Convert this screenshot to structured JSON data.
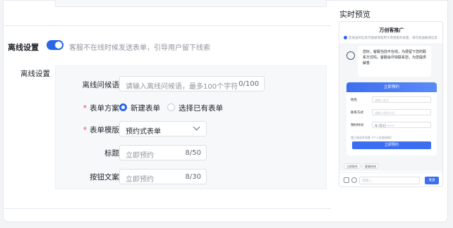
{
  "offline": {
    "label": "离线设置",
    "toggle_on": true,
    "description": "客服不在线时候发送表单，引导用户留下线索",
    "section_label": "离线设置"
  },
  "form": {
    "greeting": {
      "label": "离线问候语",
      "placeholder": "请输入离线问候语，最多100个字符",
      "count": "0/100"
    },
    "scheme": {
      "label": "表单方案",
      "required": "*",
      "options": [
        "新建表单",
        "选择已有表单"
      ],
      "selected": "新建表单"
    },
    "template": {
      "label": "表单模版",
      "required": "*",
      "value": "预约式表单"
    },
    "title": {
      "label": "标题",
      "value": "立即预约",
      "count": "8/50"
    },
    "button_text": {
      "label": "按钮文案",
      "value": "立即预约",
      "count": "8/30"
    }
  },
  "preview": {
    "title": "实时预览",
    "app_name": "万创客推广",
    "notice": "您发送的信息可能被保留用于改善服务质量，请勿发送敏感信息",
    "bubble_text": "您好，客服当前不在线，为便留下您的联系方式吗，客服会尽快联系您，为您提供解答",
    "form_card": {
      "header": "立即预约",
      "fields": [
        {
          "label": "姓名",
          "placeholder": "请输入姓名"
        },
        {
          "label": "联系方式",
          "placeholder": "请输入联系方式"
        },
        {
          "label": "预约时间",
          "placeholder": "年 /月/日  --:--:--"
        }
      ],
      "agreement": "我已阅读并同意《个人信息授权》",
      "submit": "立即预约"
    },
    "chips": [
      "立即联系",
      "客服热线"
    ],
    "input_placeholder": "请输入...",
    "send": "发送"
  },
  "colors": {
    "accent": "#2b66e6",
    "required": "#e5484d"
  }
}
